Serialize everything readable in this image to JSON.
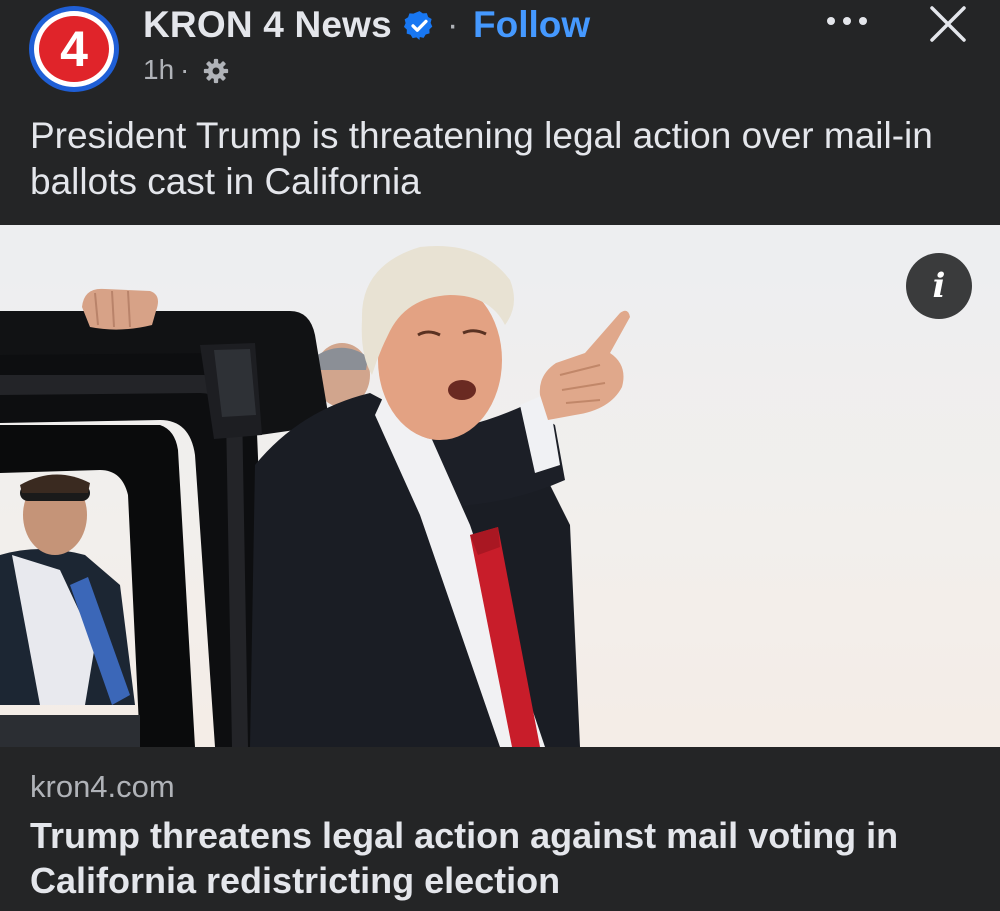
{
  "header": {
    "page_name": "KRON 4 News",
    "dot_separator": "·",
    "follow_label": "Follow",
    "time": "1h",
    "meta_separator": "·",
    "avatar_text": "4",
    "avatar_icon": "kron4-logo",
    "verified_icon": "verified-badge-icon",
    "audience_icon": "gear-icon",
    "more_icon": "more-options-icon",
    "close_icon": "close-icon"
  },
  "post": {
    "caption": "President Trump is threatening legal action over mail-in ballots cast in California"
  },
  "photo": {
    "info_label": "i"
  },
  "link": {
    "domain": "kron4.com",
    "headline": "Trump threatens legal action against mail voting in California redistricting election"
  },
  "colors": {
    "background": "#242526",
    "text_primary": "#e4e6eb",
    "text_secondary": "#b0b3b8",
    "follow_blue": "#4599ff",
    "verified_blue": "#1877f2",
    "logo_red": "#e0242a",
    "logo_blue": "#1f5fd6"
  }
}
